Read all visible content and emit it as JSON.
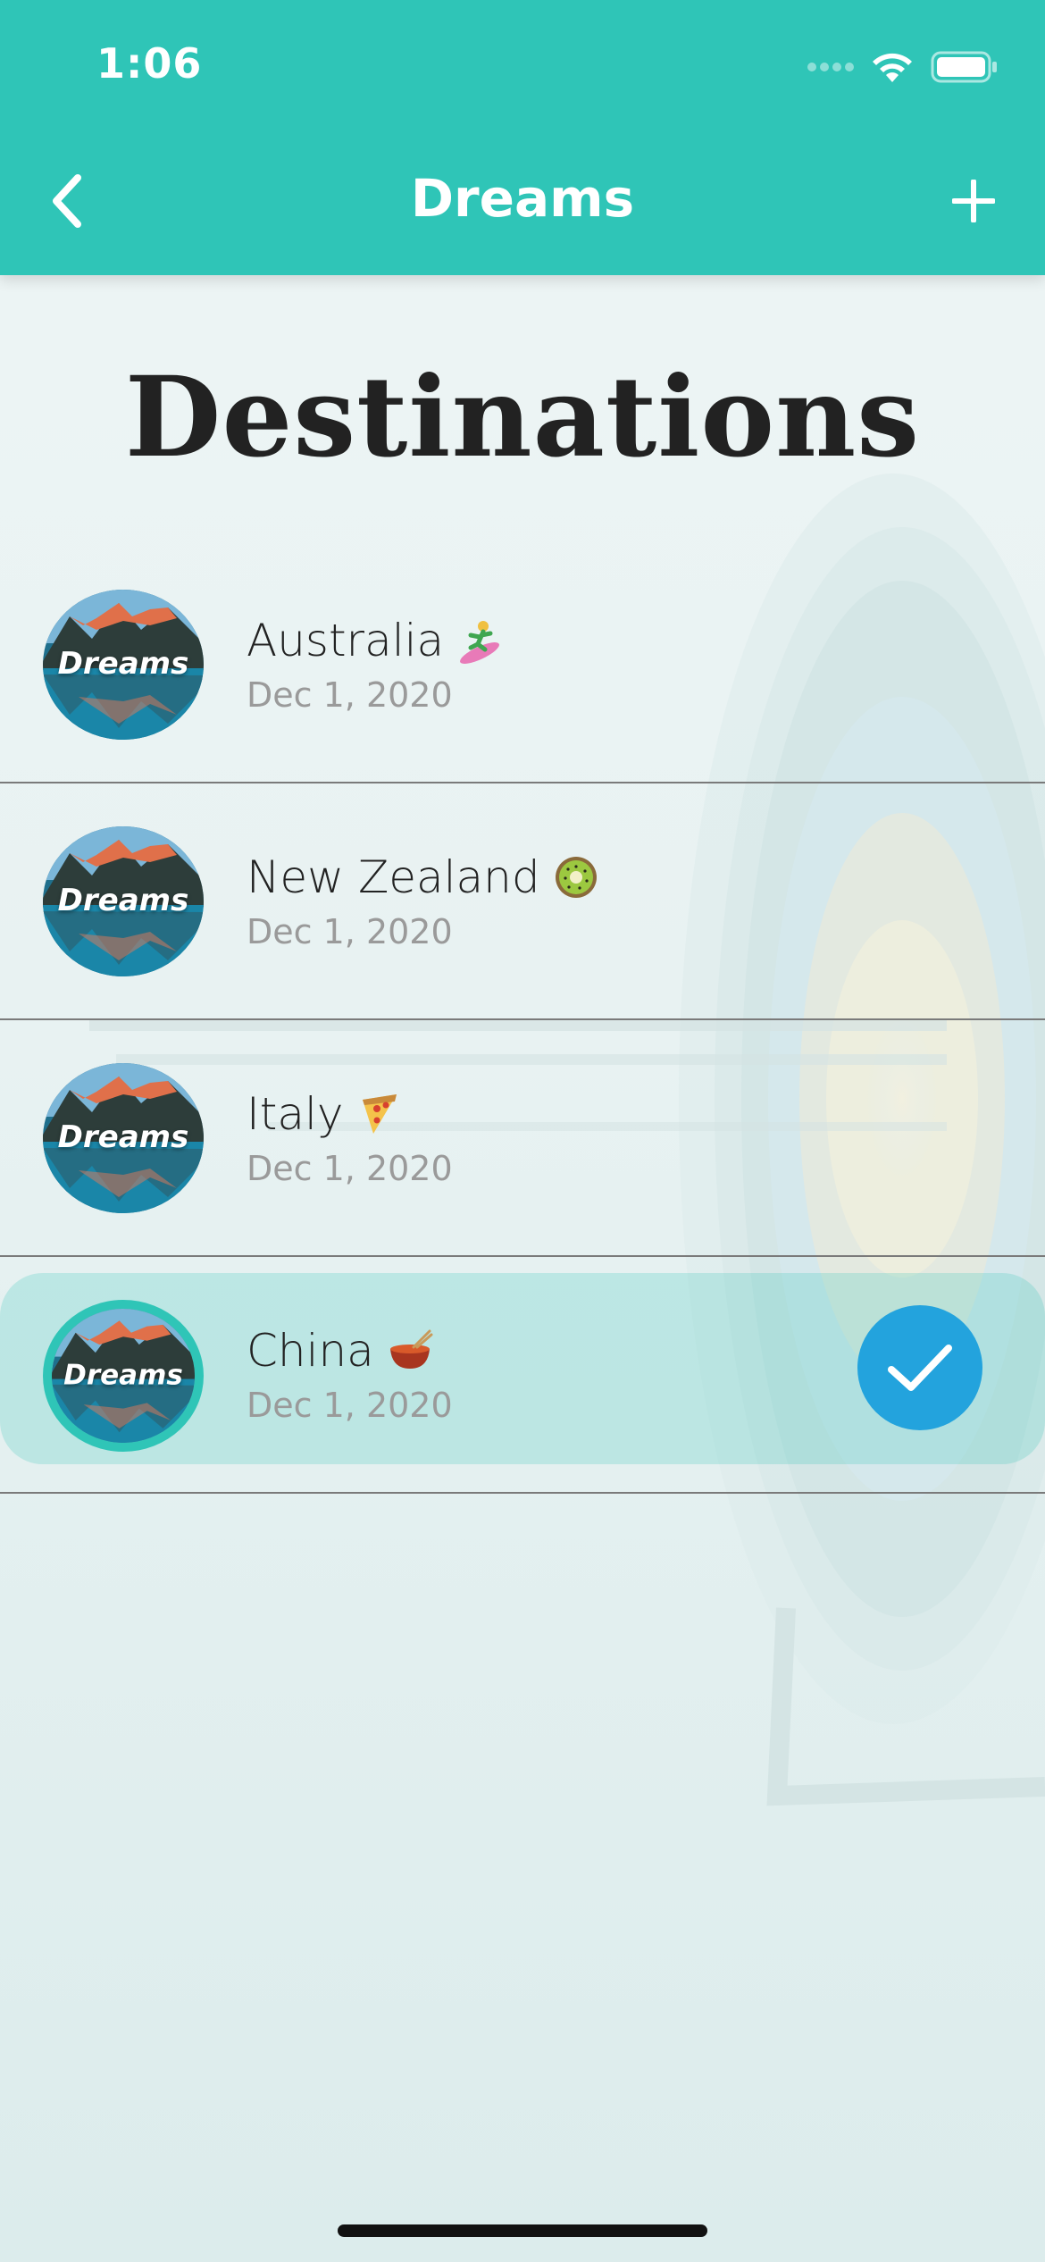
{
  "status_bar": {
    "time": "1:06"
  },
  "nav": {
    "title": "Dreams",
    "back_icon": "chevron-left-icon",
    "add_icon": "plus-icon"
  },
  "page": {
    "title": "Destinations"
  },
  "destinations": [
    {
      "name": "Australia",
      "emoji": "surfer",
      "date": "Dec 1, 2020",
      "avatar_label": "Dreams",
      "selected": false
    },
    {
      "name": "New Zealand",
      "emoji": "kiwi-fruit",
      "date": "Dec 1, 2020",
      "avatar_label": "Dreams",
      "selected": false
    },
    {
      "name": "Italy",
      "emoji": "pizza",
      "date": "Dec 1, 2020",
      "avatar_label": "Dreams",
      "selected": false
    },
    {
      "name": "China",
      "emoji": "hot-pot",
      "date": "Dec 1, 2020",
      "avatar_label": "Dreams",
      "selected": true
    }
  ],
  "colors": {
    "header": "#2fc5b7",
    "check_badge": "#23a3dd",
    "selected_row": "#bfe9e5",
    "title_text": "#222222",
    "date_text": "#9a9a9a"
  }
}
